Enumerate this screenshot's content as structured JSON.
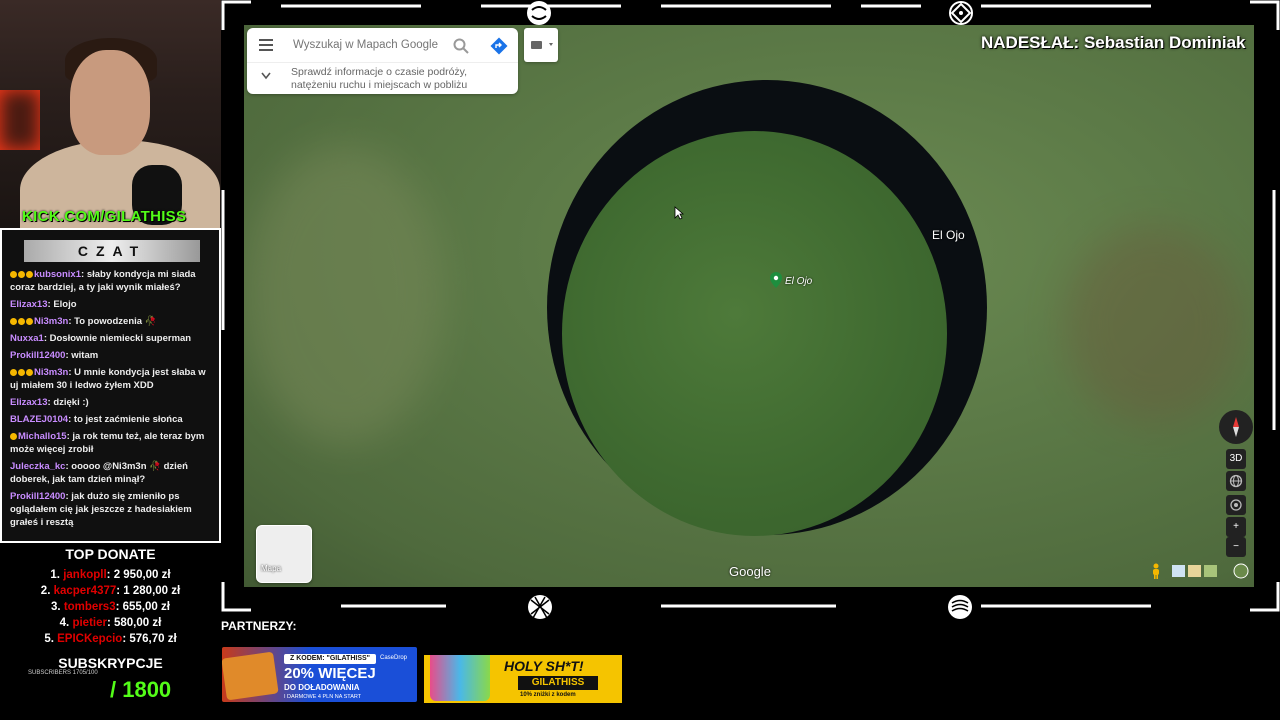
{
  "stream": {
    "channel_url": "KICK.COM/GILATHISS",
    "submitted_by": "NADESŁAŁ: Sebastian Dominiak",
    "partners_label": "PARTNERZY:"
  },
  "chat": {
    "header": "CZAT",
    "messages": [
      {
        "user": "kubsonix1",
        "text": "słaby kondycja mi siada coraz bardziej, a ty jaki wynik miałeś?",
        "badges": 3
      },
      {
        "user": "Elizax13",
        "text": "Elojo",
        "badges": 0
      },
      {
        "user": "Ni3m3n",
        "text": "To powodzenia 🥀",
        "badges": 3
      },
      {
        "user": "Nuxxa1",
        "text": "Dosłownie niemiecki superman",
        "badges": 0
      },
      {
        "user": "Prokill12400",
        "text": "witam",
        "badges": 0
      },
      {
        "user": "Ni3m3n",
        "text": "U mnie kondycja jest słaba w uj miałem 30 i ledwo żyłem XDD",
        "badges": 3
      },
      {
        "user": "Elizax13",
        "text": "dzięki :)",
        "badges": 0
      },
      {
        "user": "BLAZEJ0104",
        "text": "to jest zaćmienie słońca",
        "badges": 0
      },
      {
        "user": "Michallo15",
        "text": "ja rok temu też, ale teraz bym może więcej zrobił",
        "badges": 1
      },
      {
        "user": "Juleczka_kc",
        "text": "ooooo @Ni3m3n 🥀 dzień doberek, jak tam dzień minął?",
        "badges": 0
      },
      {
        "user": "Prokill12400",
        "text": "jak dużo się zmieniło ps oglądałem cię jak jeszcze z hadesiakiem grałeś i resztą",
        "badges": 0
      }
    ]
  },
  "donations": {
    "title": "TOP DONATE",
    "items": [
      {
        "rank": "1.",
        "name": "jankopll",
        "amount": "2 950,00 zł"
      },
      {
        "rank": "2.",
        "name": "kacper4377",
        "amount": "1 280,00 zł"
      },
      {
        "rank": "3.",
        "name": "tombers3",
        "amount": "655,00 zł"
      },
      {
        "rank": "4.",
        "name": "pietier",
        "amount": "580,00 zł"
      },
      {
        "rank": "5.",
        "name": "EPICKepcio",
        "amount": "576,70 zł"
      }
    ]
  },
  "subs": {
    "title": "SUBSKRYPCJE",
    "small": "SUBSCRIBERS 1705/100",
    "goal": "/ 1800"
  },
  "maps": {
    "search_placeholder": "Wyszukaj w Mapach Google",
    "info_text": "Sprawdź informacje o czasie podróży, natężeniu ruchu i miejscach w pobliżu",
    "place_label_large": "El Ojo",
    "place_label_pin": "El Ojo",
    "google_logo": "Google",
    "layers_label": "Mapa",
    "view_3d": "3D",
    "zoom_in": "+",
    "zoom_out": "−"
  },
  "banners": {
    "casedrop": {
      "code": "Z KODEM: \"GILATHISS\"",
      "headline": "20% WIĘCEJ",
      "sub": "DO DOŁADOWANIA",
      "small": "I DARMOWE 4 PLN NA START",
      "brand": "CaseDrop"
    },
    "holyshot": {
      "headline": "HOLY SH*T!",
      "code": "GILATHISS",
      "small": "10% zniżki z kodem"
    }
  },
  "colors": {
    "kick_green": "#53fc18",
    "donor_red": "#e00000",
    "chat_user": "#c88cff",
    "map_water": "#0a0e12"
  }
}
